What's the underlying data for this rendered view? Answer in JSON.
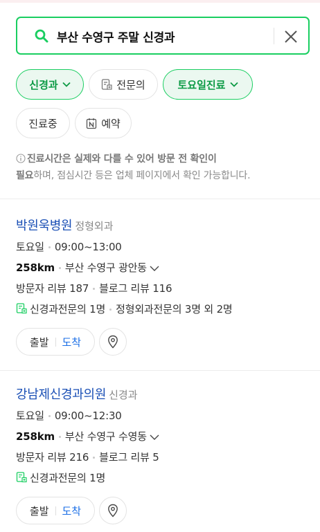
{
  "search": {
    "query": "부산 수영구 주말 신경과",
    "search_icon": "search-icon",
    "clear_icon": "close-icon"
  },
  "filters": {
    "row1": [
      {
        "label": "신경과",
        "active": true,
        "icon": "chevron-down-icon"
      },
      {
        "label": "전문의",
        "active": false,
        "icon": "specialist-doc-icon"
      },
      {
        "label": "토요일진료",
        "active": true,
        "icon": "chevron-down-icon"
      }
    ],
    "row2": [
      {
        "label": "진료중",
        "active": false
      },
      {
        "label": "예약",
        "active": false,
        "icon": "naver-booking-icon"
      }
    ]
  },
  "notice": {
    "bold_1": "진료시간은 실제와 다를 수 있어 방문 전 확인이",
    "bold_2": "필요",
    "rest": "하며, 점심시간 등은 업체 페이지에서 확인 가능합니다."
  },
  "results": [
    {
      "name": "박원욱병원",
      "category": "정형외과",
      "day": "토요일",
      "hours": "09:00~13:00",
      "distance": "258km",
      "location": "부산 수영구 광안동",
      "visitor_reviews": "방문자 리뷰 187",
      "blog_reviews": "블로그 리뷰 116",
      "specialist_1": "신경과전문의 1명",
      "specialist_2": "정형외과전문의 3명 외 2명",
      "depart_label": "출발",
      "arrive_label": "도착"
    },
    {
      "name": "강남제신경과의원",
      "category": "신경과",
      "day": "토요일",
      "hours": "09:00~12:30",
      "distance": "258km",
      "location": "부산 수영구 수영동",
      "visitor_reviews": "방문자 리뷰 216",
      "blog_reviews": "블로그 리뷰 5",
      "specialist_1": "신경과전문의 1명",
      "depart_label": "출발",
      "arrive_label": "도착"
    }
  ],
  "colors": {
    "accent_green": "#19ce60",
    "link_blue": "#1a4fb5",
    "arrive_blue": "#1a6ee6"
  }
}
